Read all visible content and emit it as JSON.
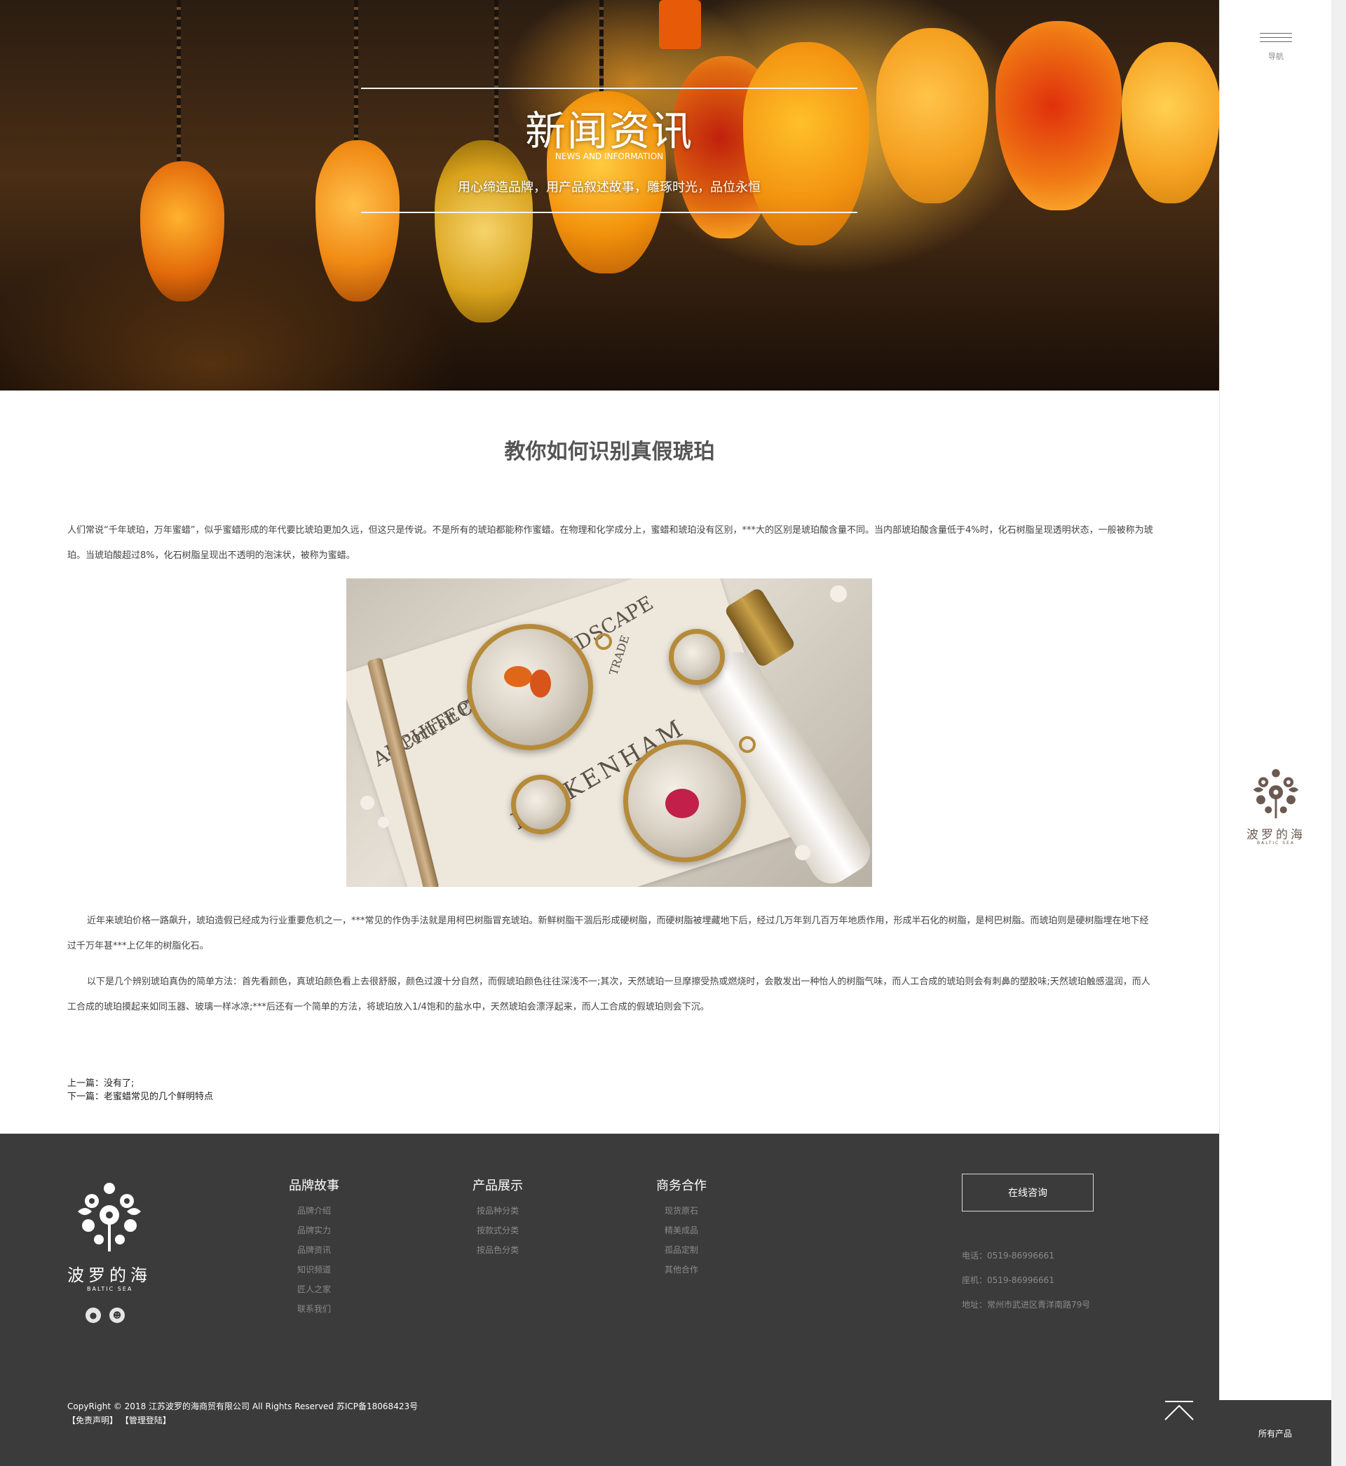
{
  "hero": {
    "title": "新闻资讯",
    "subtitle_en": "NEWS AND INFORMATION",
    "slogan": "用心缔造品牌，用产品叙述故事，雕琢时光，品位永恒"
  },
  "article": {
    "title": "教你如何识别真假琥珀",
    "paragraph_1": "人们常说“千年琥珀，万年蜜蜡”，似乎蜜蜡形成的年代要比琥珀更加久远，但这只是传说。不是所有的琥珀都能称作蜜蜡。在物理和化学成分上，蜜蜡和琥珀没有区别，***大的区别是琥珀酸含量不同。当内部琥珀酸含量低于4%时，化石树脂呈现透明状态，一般被称为琥珀。当琥珀酸超过8%，化石树脂呈现出不透明的泡沫状，被称为蜜蜡。",
    "image_text_1": "ARCHITECTURAL LANDSCAPE",
    "image_text_2": "& Portrait Photographer",
    "image_text_3": "PECKENHAM",
    "image_text_4": "TRADE",
    "paragraph_2": "近年来琥珀价格一路飙升，琥珀造假已经成为行业重要危机之一，***常见的作伪手法就是用柯巴树脂冒充琥珀。新鲜树脂干涸后形成硬树脂，而硬树脂被埋藏地下后，经过几万年到几百万年地质作用，形成半石化的树脂，是柯巴树脂。而琥珀则是硬树脂埋在地下经过千万年甚***上亿年的树脂化石。",
    "paragraph_3": "以下是几个辨别琥珀真伪的简单方法：首先看颜色，真琥珀颜色看上去很舒服，颜色过渡十分自然，而假琥珀颜色往往深浅不一;其次，天然琥珀一旦摩擦受热或燃烧时，会散发出一种怡人的树脂气味，而人工合成的琥珀则会有刺鼻的塑胶味;天然琥珀触感温润，而人工合成的琥珀摸起来如同玉器、玻璃一样冰凉;***后还有一个简单的方法，将琥珀放入1/4饱和的盐水中，天然琥珀会漂浮起来，而人工合成的假琥珀则会下沉。",
    "prev": "上一篇：没有了;",
    "next": "下一篇：老蜜蜡常见的几个鲜明特点"
  },
  "footer": {
    "logo_cn": "波罗的海",
    "logo_en": "BALTIC SEA",
    "columns": [
      {
        "title": "品牌故事",
        "items": [
          "品牌介绍",
          "品牌实力",
          "品牌资讯",
          "知识频道",
          "匠人之家",
          "联系我们"
        ]
      },
      {
        "title": "产品展示",
        "items": [
          "按品种分类",
          "按款式分类",
          "按品色分类"
        ]
      },
      {
        "title": "商务合作",
        "items": [
          "现货原石",
          "精美成品",
          "孤品定制",
          "其他合作"
        ]
      }
    ],
    "consult_button": "在线咨询",
    "phone": "电话：0519-86996661",
    "landline": "座机：0519-86996661",
    "address": "地址：常州市武进区青洋南路79号",
    "copyright": "CopyRight © 2018 江苏波罗的海商贸有限公司 All Rights Reserved 苏ICP备18068423号",
    "disclaimer": "【免责声明】",
    "admin_login": "【管理登陆】"
  },
  "sidebar": {
    "menu_label": "导航",
    "logo_cn": "波罗的海",
    "logo_en": "BALTIC SEA",
    "all_products": "所有产品"
  },
  "icons": [
    "menu-icon",
    "qq-icon",
    "wechat-icon",
    "back-to-top-icon",
    "floral-logo-icon"
  ],
  "colors": {
    "footer_bg": "#3b3b3b",
    "accent_logo": "#6a5a52",
    "hero_amber": "#f0a020"
  }
}
